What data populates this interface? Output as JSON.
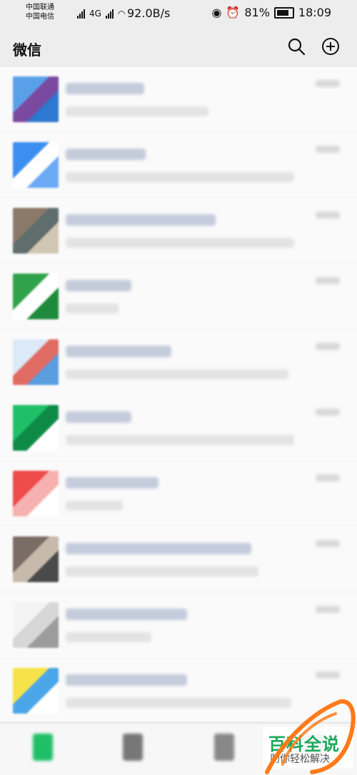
{
  "status_bar": {
    "carrier1": "中国联通",
    "carrier2": "中国电信",
    "network": "4G",
    "speed": "92.0B/s",
    "battery": "81%",
    "time": "18:09"
  },
  "header": {
    "title": "微信",
    "search_icon": "search-icon",
    "add_icon": "plus-circle-icon"
  },
  "chats": [
    {
      "colors": [
        "#5aa0e8",
        "#7a4aa0",
        "#2d78d0"
      ]
    },
    {
      "colors": [
        "#3c8ef0",
        "#ffffff",
        "#6ba9f5"
      ]
    },
    {
      "colors": [
        "#8b7a6a",
        "#5f6d6d",
        "#d2c6b4"
      ]
    },
    {
      "colors": [
        "#2fa24a",
        "#ffffff",
        "#1f8a3b"
      ]
    },
    {
      "colors": [
        "#dce9f7",
        "#df6b63",
        "#5a9de0"
      ]
    },
    {
      "colors": [
        "#1fbf68",
        "#0e8a47",
        "#ffffff"
      ]
    },
    {
      "colors": [
        "#ee4b4b",
        "#f7b1b1",
        "#ffffff"
      ]
    },
    {
      "colors": [
        "#7a6d66",
        "#c8b9ad",
        "#4a4a4a"
      ]
    },
    {
      "colors": [
        "#f4f4f4",
        "#d7d7d7",
        "#9c9c9c"
      ]
    },
    {
      "colors": [
        "#f6e34a",
        "#4aa6e8",
        "#ffffff"
      ]
    }
  ],
  "tabs": [
    {
      "name": "chats-tab",
      "color": "#1fbf68"
    },
    {
      "name": "contacts-tab",
      "color": "#777777"
    },
    {
      "name": "discover-tab",
      "color": "#888888"
    },
    {
      "name": "me-tab",
      "color": "#666666"
    }
  ],
  "watermark": {
    "main": "百科全说",
    "sub": "助你轻松解决"
  }
}
